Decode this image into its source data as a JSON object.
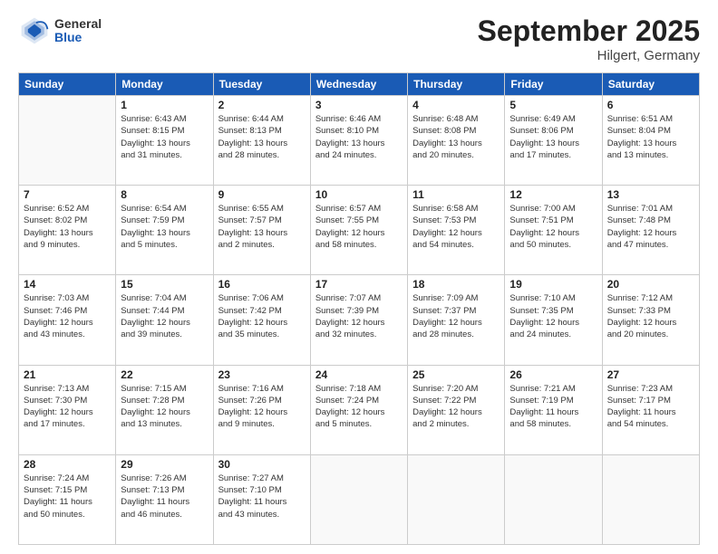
{
  "header": {
    "logo_general": "General",
    "logo_blue": "Blue",
    "title": "September 2025",
    "subtitle": "Hilgert, Germany"
  },
  "calendar": {
    "days_of_week": [
      "Sunday",
      "Monday",
      "Tuesday",
      "Wednesday",
      "Thursday",
      "Friday",
      "Saturday"
    ],
    "weeks": [
      [
        {
          "day": "",
          "info": ""
        },
        {
          "day": "1",
          "info": "Sunrise: 6:43 AM\nSunset: 8:15 PM\nDaylight: 13 hours\nand 31 minutes."
        },
        {
          "day": "2",
          "info": "Sunrise: 6:44 AM\nSunset: 8:13 PM\nDaylight: 13 hours\nand 28 minutes."
        },
        {
          "day": "3",
          "info": "Sunrise: 6:46 AM\nSunset: 8:10 PM\nDaylight: 13 hours\nand 24 minutes."
        },
        {
          "day": "4",
          "info": "Sunrise: 6:48 AM\nSunset: 8:08 PM\nDaylight: 13 hours\nand 20 minutes."
        },
        {
          "day": "5",
          "info": "Sunrise: 6:49 AM\nSunset: 8:06 PM\nDaylight: 13 hours\nand 17 minutes."
        },
        {
          "day": "6",
          "info": "Sunrise: 6:51 AM\nSunset: 8:04 PM\nDaylight: 13 hours\nand 13 minutes."
        }
      ],
      [
        {
          "day": "7",
          "info": "Sunrise: 6:52 AM\nSunset: 8:02 PM\nDaylight: 13 hours\nand 9 minutes."
        },
        {
          "day": "8",
          "info": "Sunrise: 6:54 AM\nSunset: 7:59 PM\nDaylight: 13 hours\nand 5 minutes."
        },
        {
          "day": "9",
          "info": "Sunrise: 6:55 AM\nSunset: 7:57 PM\nDaylight: 13 hours\nand 2 minutes."
        },
        {
          "day": "10",
          "info": "Sunrise: 6:57 AM\nSunset: 7:55 PM\nDaylight: 12 hours\nand 58 minutes."
        },
        {
          "day": "11",
          "info": "Sunrise: 6:58 AM\nSunset: 7:53 PM\nDaylight: 12 hours\nand 54 minutes."
        },
        {
          "day": "12",
          "info": "Sunrise: 7:00 AM\nSunset: 7:51 PM\nDaylight: 12 hours\nand 50 minutes."
        },
        {
          "day": "13",
          "info": "Sunrise: 7:01 AM\nSunset: 7:48 PM\nDaylight: 12 hours\nand 47 minutes."
        }
      ],
      [
        {
          "day": "14",
          "info": "Sunrise: 7:03 AM\nSunset: 7:46 PM\nDaylight: 12 hours\nand 43 minutes."
        },
        {
          "day": "15",
          "info": "Sunrise: 7:04 AM\nSunset: 7:44 PM\nDaylight: 12 hours\nand 39 minutes."
        },
        {
          "day": "16",
          "info": "Sunrise: 7:06 AM\nSunset: 7:42 PM\nDaylight: 12 hours\nand 35 minutes."
        },
        {
          "day": "17",
          "info": "Sunrise: 7:07 AM\nSunset: 7:39 PM\nDaylight: 12 hours\nand 32 minutes."
        },
        {
          "day": "18",
          "info": "Sunrise: 7:09 AM\nSunset: 7:37 PM\nDaylight: 12 hours\nand 28 minutes."
        },
        {
          "day": "19",
          "info": "Sunrise: 7:10 AM\nSunset: 7:35 PM\nDaylight: 12 hours\nand 24 minutes."
        },
        {
          "day": "20",
          "info": "Sunrise: 7:12 AM\nSunset: 7:33 PM\nDaylight: 12 hours\nand 20 minutes."
        }
      ],
      [
        {
          "day": "21",
          "info": "Sunrise: 7:13 AM\nSunset: 7:30 PM\nDaylight: 12 hours\nand 17 minutes."
        },
        {
          "day": "22",
          "info": "Sunrise: 7:15 AM\nSunset: 7:28 PM\nDaylight: 12 hours\nand 13 minutes."
        },
        {
          "day": "23",
          "info": "Sunrise: 7:16 AM\nSunset: 7:26 PM\nDaylight: 12 hours\nand 9 minutes."
        },
        {
          "day": "24",
          "info": "Sunrise: 7:18 AM\nSunset: 7:24 PM\nDaylight: 12 hours\nand 5 minutes."
        },
        {
          "day": "25",
          "info": "Sunrise: 7:20 AM\nSunset: 7:22 PM\nDaylight: 12 hours\nand 2 minutes."
        },
        {
          "day": "26",
          "info": "Sunrise: 7:21 AM\nSunset: 7:19 PM\nDaylight: 11 hours\nand 58 minutes."
        },
        {
          "day": "27",
          "info": "Sunrise: 7:23 AM\nSunset: 7:17 PM\nDaylight: 11 hours\nand 54 minutes."
        }
      ],
      [
        {
          "day": "28",
          "info": "Sunrise: 7:24 AM\nSunset: 7:15 PM\nDaylight: 11 hours\nand 50 minutes."
        },
        {
          "day": "29",
          "info": "Sunrise: 7:26 AM\nSunset: 7:13 PM\nDaylight: 11 hours\nand 46 minutes."
        },
        {
          "day": "30",
          "info": "Sunrise: 7:27 AM\nSunset: 7:10 PM\nDaylight: 11 hours\nand 43 minutes."
        },
        {
          "day": "",
          "info": ""
        },
        {
          "day": "",
          "info": ""
        },
        {
          "day": "",
          "info": ""
        },
        {
          "day": "",
          "info": ""
        }
      ]
    ]
  }
}
